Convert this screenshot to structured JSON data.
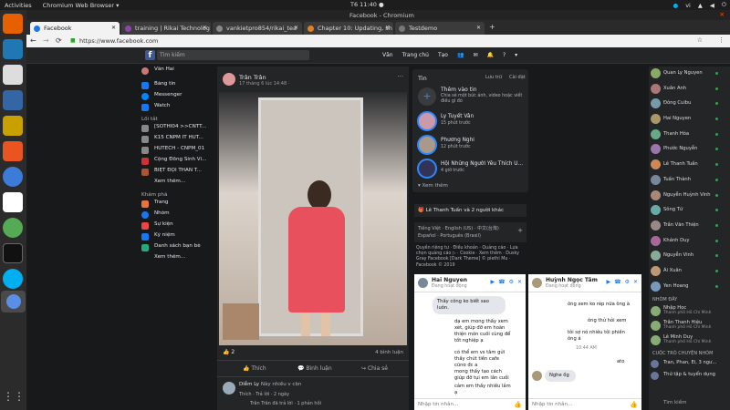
{
  "system": {
    "activities": "Activities",
    "browser_app": "Chromium Web Browser ▾",
    "clock": "T6 11:40 ●",
    "lang": "vi"
  },
  "window": {
    "title": "Facebook - Chromium"
  },
  "tabs": [
    {
      "label": "Facebook",
      "active": true,
      "color": "#1877f2"
    },
    {
      "label": "training | Rikai Technolog",
      "active": false,
      "color": "#8e44ad"
    },
    {
      "label": "vankietpro854/rikai_tea",
      "active": false,
      "color": "#333"
    },
    {
      "label": "Chapter 10: Updating, sh",
      "active": false,
      "color": "#e67e22"
    },
    {
      "label": "Testdemo",
      "active": false,
      "color": "#555"
    }
  ],
  "address": {
    "url": "https://www.facebook.com"
  },
  "fb_header": {
    "search_placeholder": "Tìm kiếm",
    "user": "Văn",
    "home": "Trang chủ",
    "create": "Tạo"
  },
  "left_nav": {
    "profile": "Văn Hai",
    "items": [
      "Bảng tin",
      "Messenger",
      "Watch"
    ],
    "shortcuts_title": "Lối tắt",
    "shortcuts": [
      "[SOTHI04 >>CNTT...",
      "K15 CNPM IT HUT...",
      "HUTECH - CNPM_01",
      "Cộng Đồng Sinh Vi...",
      "BIỆT ĐỘI THẦN T..."
    ],
    "see_more": "Xem thêm...",
    "explore_title": "Khám phá",
    "explore": [
      "Trang",
      "Nhóm",
      "Sự kiện",
      "Kỷ niệm",
      "Danh sách bạn bè"
    ],
    "explore_see_more": "Xem thêm..."
  },
  "post": {
    "author": "Trân Trân",
    "time": "17 tháng 6 lúc 14:48 · ",
    "reactions": "2",
    "comments": "4 bình luận",
    "actions": [
      "Thích",
      "Bình luận",
      "Chia sẻ"
    ],
    "commenter": "Diễm Ly",
    "comment_text": "Này nhiều v cbn",
    "comment_actions": "Thích · Trả lời · 2 ngày",
    "reply": "Trân Trân đã trả lời · 1 phản hồi"
  },
  "stories": {
    "title": "Tin",
    "archive": "Lưu trữ",
    "settings": "Cài đặt",
    "add_title": "Thêm vào tin",
    "add_desc": "Chia sẻ một bức ảnh, video hoặc viết điều gì đó",
    "items": [
      {
        "name": "Ly Tuyết Vân",
        "time": "15 phút trước"
      },
      {
        "name": "Phương Nghi",
        "time": "12 phút trước"
      },
      {
        "name": "Hội Những Người Yêu Thích U...",
        "time": "4 giờ trước"
      }
    ],
    "see_more": "Xem thêm"
  },
  "misc": {
    "birthday": "Lê Thanh Tuấn và 2 người khác",
    "languages": "Tiếng Việt · English (US) · 中文(台灣)",
    "languages2": "Español · Português (Brasil)",
    "footer": "Quyền riêng tư · Điều khoản · Quảng cáo · Lựa chọn quảng cáo ▷ · Cookie · Xem thêm · Dusky Gray Facebook [Dark Theme] © piethi Mu · Facebook © 2019"
  },
  "chat1": {
    "name": "Hai Nguyen",
    "status": "Đang hoạt động",
    "messages": [
      "Thấy công ko biết sao luôn.",
      "dạ em mong thấy xem xét, giúp đỡ em hoàn thiện môn cuối cùng để tốt nghiệp ạ",
      "có thể em vs tâm gửi thấy chút tiền cafe cũng đc ạ",
      "mong thấy tạo cách giúp đỡ tụi em lần cuối này",
      "cảm em thấy nhiều lắm ạ"
    ],
    "input": "Nhập tin nhắn..."
  },
  "chat2": {
    "name": "Huỳnh Ngọc Tâm",
    "status": "Đang hoạt động",
    "messages": [
      "ông xem ko rép nữa ông à",
      "ông thử hỏi xem",
      "tôi sợ nó nhiêu tôi phiền ông á",
      "10:44 AM",
      "ato",
      "Nghe ốg"
    ],
    "input": "Nhập tin nhắn..."
  },
  "contacts": {
    "list": [
      "Quan Ly Nguyen",
      "Xuân Anh",
      "Đông Cuibu",
      "Hai Nguyen",
      "Thanh Hòa",
      "Phước Nguyễn",
      "Lê Thanh Tuấn",
      "Tuấn Thành",
      "Nguyễn Huỳnh Vinh",
      "Sông Tứ",
      "Trần Văn Thiện",
      "Khánh Duy",
      "Nguyễn Vinh",
      "Ái Xuân",
      "Yen Hoang"
    ],
    "groups_title": "NHÓM ĐÂY",
    "groups": [
      {
        "name": "Nhập Học",
        "sub": "Thanh phố Hồ Chí Minh"
      },
      {
        "name": "Trần Thanh Hiệu",
        "sub": "Thanh phố Hồ Chí Minh"
      },
      {
        "name": "Lê Minh Duy",
        "sub": "Thanh phố Hồ Chí Minh"
      }
    ],
    "convos_title": "CUỘC TRÒ CHUYỆN NHÓM",
    "convos": [
      "Tran, Phan, Ei, 3 ngư...",
      "Thứ tập & tuyển dụng"
    ],
    "search_placeholder": "Tìm kiếm"
  }
}
